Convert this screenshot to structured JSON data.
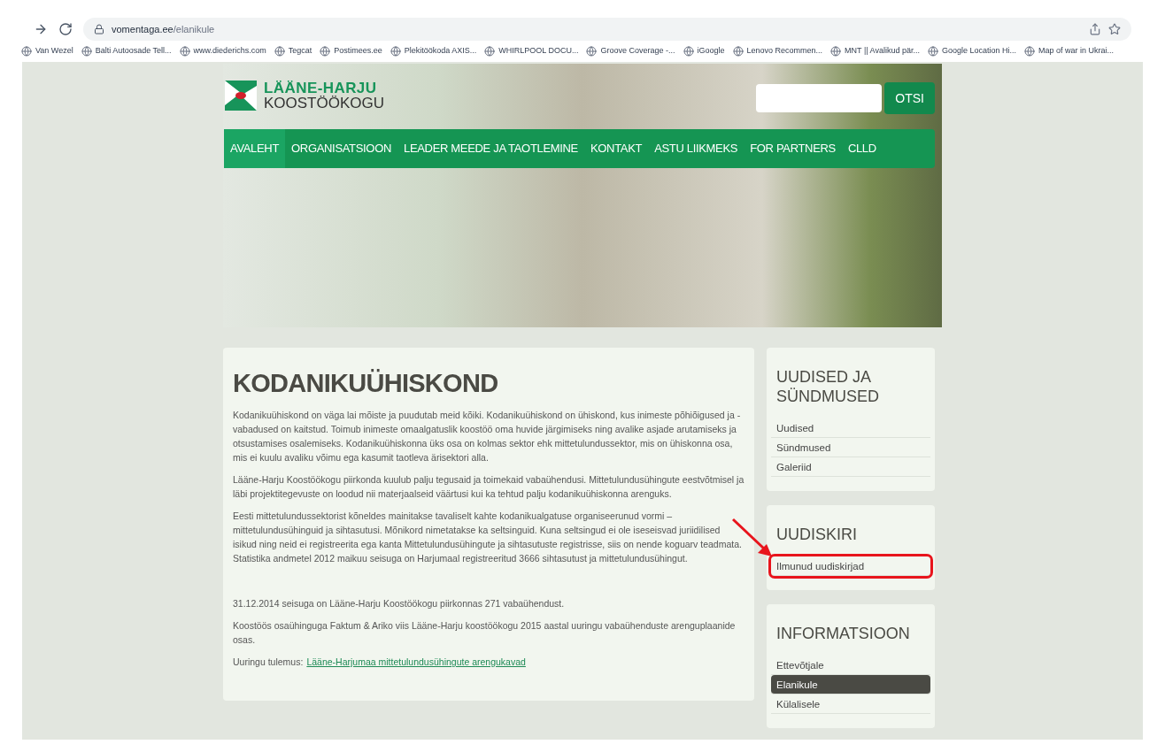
{
  "browser": {
    "url_host": "vomentaga.ee",
    "url_path": "/elanikule",
    "bookmarks": [
      "Van Wezel",
      "Balti Autoosade Tell...",
      "www.diederichs.com",
      "Tegcat",
      "Postimees.ee",
      "Plekitöökoda AXIS...",
      "WHIRLPOOL DOCU...",
      "Groove Coverage -...",
      "iGoogle",
      "Lenovo Recommen...",
      "MNT || Avalikud pär...",
      "Google Location Hi...",
      "Map of war in Ukrai..."
    ]
  },
  "header": {
    "logo_line1": "LÄÄNE-HARJU",
    "logo_line2": "KOOSTÖÖKOGU",
    "search_button": "OTSI",
    "nav": [
      {
        "label": "AVALEHT",
        "selected": true
      },
      {
        "label": "ORGANISATSIOON",
        "selected": false
      },
      {
        "label": "LEADER MEEDE JA TAOTLEMINE",
        "selected": false
      },
      {
        "label": "KONTAKT",
        "selected": false
      },
      {
        "label": "ASTU LIIKMEKS",
        "selected": false
      },
      {
        "label": "FOR PARTNERS",
        "selected": false
      },
      {
        "label": "CLLD",
        "selected": false
      }
    ]
  },
  "article": {
    "title": "KODANIKUÜHISKOND",
    "paragraphs": [
      "Kodanikuühiskond on väga lai mõiste ja puudutab meid kõiki. Kodanikuühiskond on ühiskond, kus inimeste põhiõigused ja -vabadused on kaitstud. Toimub inimeste omaalgatuslik koostöö oma huvide järgimiseks ning avalike asjade arutamiseks ja otsustamises osalemiseks. Kodanikuühiskonna üks osa on kolmas sektor ehk mittetulundussektor, mis on ühiskonna osa, mis ei kuulu avaliku võimu ega kasumit taotleva ärisektori alla.",
      "Lääne-Harju Koostöökogu piirkonda kuulub palju tegusaid ja toimekaid vabaühendusi. Mittetulundusühingute eestvõtmisel ja läbi projektitegevuste on loodud nii materjaalseid väärtusi kui ka tehtud palju kodanikuühiskonna arenguks.",
      "Eesti mittetulundussektorist kõneldes mainitakse tavaliselt kahte kodanikualgatuse organiseerunud vormi – mittetulundusühinguid ja sihtasutusi. Mõnikord nimetatakse ka seltsinguid. Kuna seltsingud ei ole iseseisvad juriidilised isikud ning neid ei registreerita ega kanta Mittetulundusühingute ja sihtasutuste registrisse, siis on nende koguarv teadmata. Statistika andmetel 2012 maikuu seisuga on Harjumaal registreeritud 3666 sihtasutust ja mittetulundusühingut."
    ],
    "paragraphs2": [
      "31.12.2014 seisuga on Lääne-Harju Koostöökogu piirkonnas 271 vabaühendust.",
      "Koostöös osaühinguga Faktum & Ariko viis Lääne-Harju koostöökogu 2015 aastal uuringu vabaühenduste arenguplaanide osas."
    ],
    "result_label": "Uuringu tulemus:",
    "result_link": "Lääne-Harjumaa mittetulundusühingute arengukavad"
  },
  "sidebar": [
    {
      "title": "UUDISED JA SÜNDMUSED",
      "items": [
        {
          "label": "Uudised",
          "selected": false,
          "annotated": false
        },
        {
          "label": "Sündmused",
          "selected": false,
          "annotated": false
        },
        {
          "label": "Galeriid",
          "selected": false,
          "annotated": false
        }
      ]
    },
    {
      "title": "UUDISKIRI",
      "items": [
        {
          "label": "Ilmunud uudiskirjad",
          "selected": false,
          "annotated": true
        }
      ]
    },
    {
      "title": "INFORMATSIOON",
      "items": [
        {
          "label": "Ettevõtjale",
          "selected": false,
          "annotated": false
        },
        {
          "label": "Elanikule",
          "selected": true,
          "annotated": false
        },
        {
          "label": "Külalisele",
          "selected": false,
          "annotated": false
        }
      ]
    }
  ]
}
